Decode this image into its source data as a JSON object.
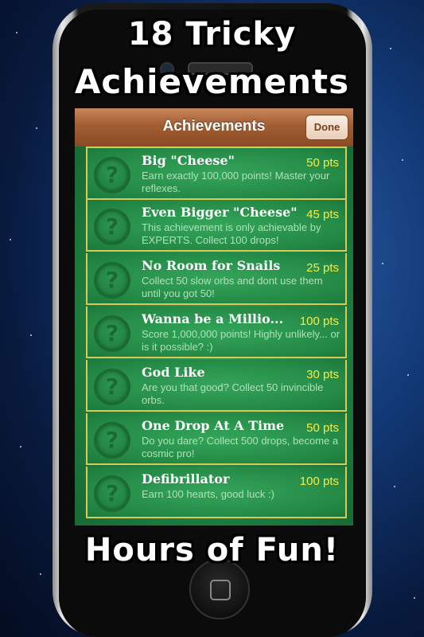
{
  "banner": {
    "top_line1": "18 Tricky",
    "top_line2": "Achievements",
    "bottom": "Hours of Fun!"
  },
  "navbar": {
    "title": "Achievements",
    "done_label": "Done"
  },
  "achievements": [
    {
      "icon": "?",
      "title": "Big \"Cheese\"",
      "points": "50 pts",
      "description": "Earn exactly 100,000 points! Master your reflexes."
    },
    {
      "icon": "?",
      "title": "Even Bigger \"Cheese\"",
      "points": "45 pts",
      "description": "This achievement is only achievable by EXPERTS. Collect 100 drops!"
    },
    {
      "icon": "?",
      "title": "No Room for Snails",
      "points": "25 pts",
      "description": "Collect 50 slow orbs and dont use them until you got 50!"
    },
    {
      "icon": "?",
      "title": "Wanna be a Millio...",
      "points": "100 pts",
      "description": "Score 1,000,000 points! Highly unlikely... or is it possible? :)"
    },
    {
      "icon": "?",
      "title": "God Like",
      "points": "30 pts",
      "description": "Are you that good? Collect 50 invincible orbs."
    },
    {
      "icon": "?",
      "title": "One Drop At A Time",
      "points": "50 pts",
      "description": "Do you dare? Collect 500 drops, become a cosmic pro!"
    },
    {
      "icon": "?",
      "title": "Defibrillator",
      "points": "100 pts",
      "description": "Earn 100 hearts, good luck :)"
    }
  ]
}
